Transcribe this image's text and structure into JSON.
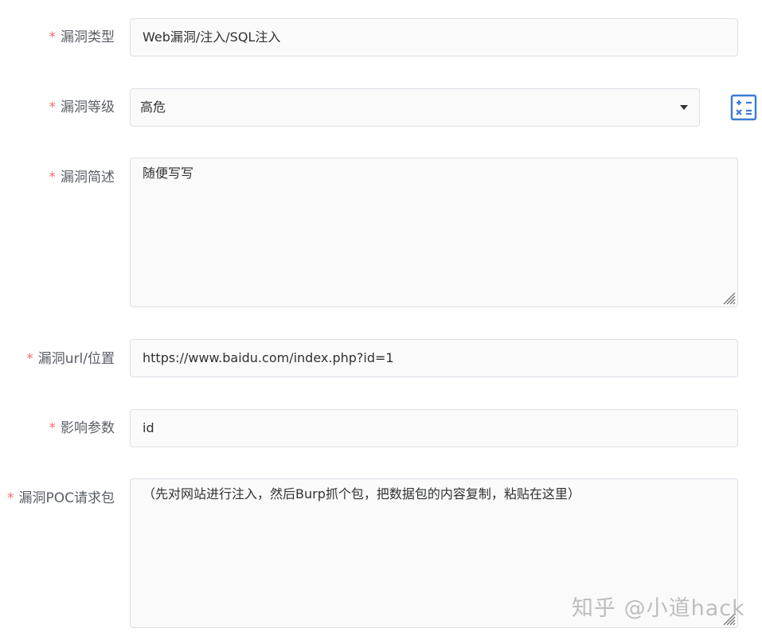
{
  "fields": {
    "type": {
      "label": "漏洞类型",
      "value": "Web漏洞/注入/SQL注入"
    },
    "level": {
      "label": "漏洞等级",
      "value": "高危"
    },
    "desc": {
      "label": "漏洞简述",
      "value": "随便写写"
    },
    "url": {
      "label": "漏洞url/位置",
      "value": "https://www.baidu.com/index.php?id=1"
    },
    "param": {
      "label": "影响参数",
      "value": "id"
    },
    "poc": {
      "label": "漏洞POC请求包",
      "value": "（先对网站进行注入，然后Burp抓个包，把数据包的内容复制，粘贴在这里）"
    }
  },
  "required_mark": "*",
  "watermark": "知乎 @小道hack",
  "icons": {
    "calculator": "calculator-icon",
    "dropdown": "caret-down-icon",
    "resize": "resize-handle-icon"
  },
  "colors": {
    "required": "#f56c6c",
    "icon": "#3a7bd5",
    "border": "#dcdfe6"
  }
}
